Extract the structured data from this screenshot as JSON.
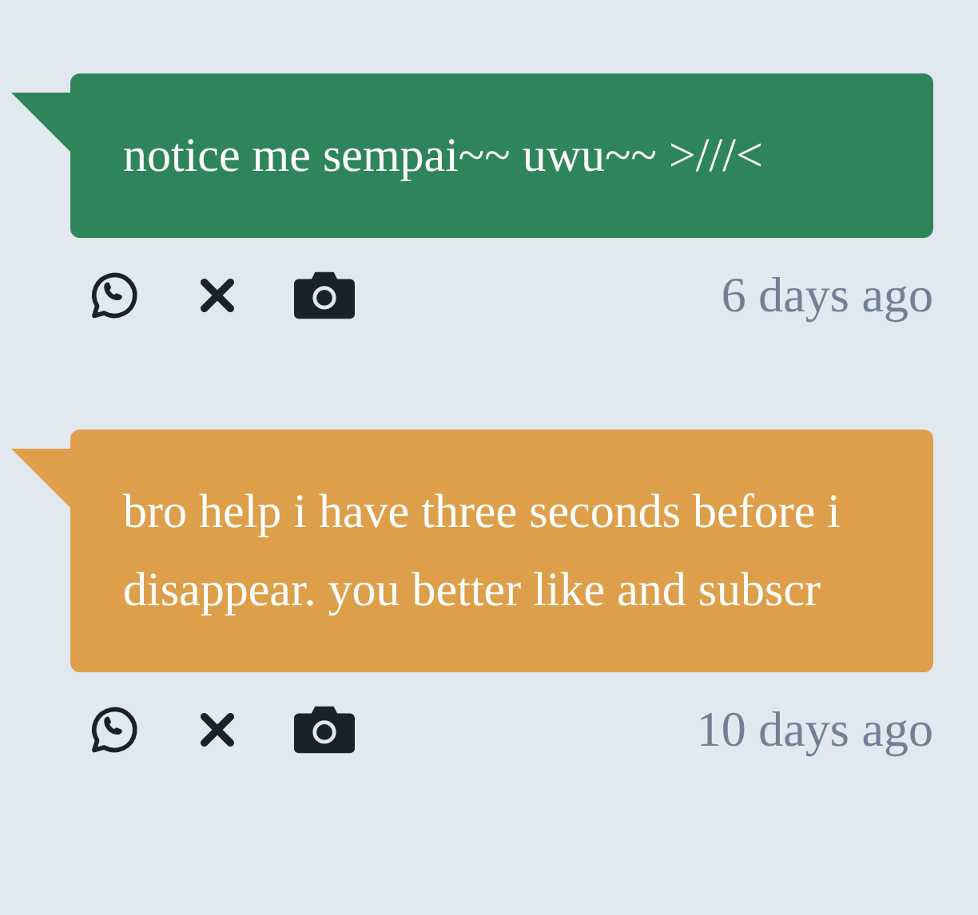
{
  "messages": [
    {
      "text": "notice me sempai~~ uwu~~ >///<",
      "color": "#2f855a",
      "time": "6 days ago"
    },
    {
      "text": "bro help i have three seconds before i disappear. you better like and subscr",
      "color": "#dd9f4a",
      "time": "10 days ago"
    }
  ]
}
